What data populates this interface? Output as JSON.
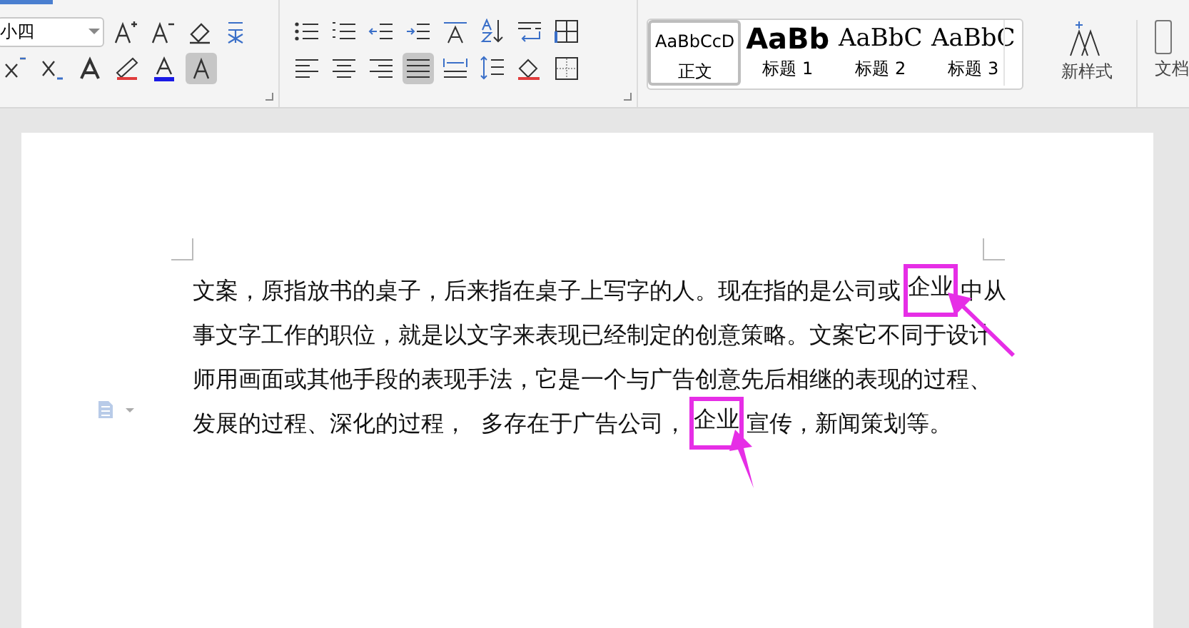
{
  "font_size": {
    "value": "小四"
  },
  "alignment": [
    {
      "kind": "left",
      "selected": false
    },
    {
      "kind": "center",
      "selected": false
    },
    {
      "kind": "right",
      "selected": false
    },
    {
      "kind": "justify",
      "selected": true
    },
    {
      "kind": "distribute",
      "selected": false
    }
  ],
  "styles": [
    {
      "kind": "normal",
      "preview": "AaBbCcD",
      "label": "正文",
      "selected": true
    },
    {
      "kind": "heading",
      "preview": "AaBb",
      "label": "标题 1",
      "selected": false
    },
    {
      "kind": "heading2",
      "preview": "AaBbC",
      "label": "标题 2",
      "selected": false
    },
    {
      "kind": "heading2",
      "preview": "AaBbC",
      "label": "标题 3",
      "selected": false
    }
  ],
  "new_style": {
    "label": "新样式"
  },
  "document_button": {
    "label": "文档"
  },
  "paragraph": [
    {
      "segments": [
        {
          "text": "文案，原指放书的桌子，后来指在桌子上写字的人。现在指的是公司或",
          "highlight": false
        },
        {
          "text": "企业",
          "highlight": true
        },
        {
          "text": "中从",
          "highlight": false
        }
      ]
    },
    {
      "segments": [
        {
          "text": "事文字工作的职位，就是以文字来表现已经制定的创意策略。文案它不同于设计",
          "highlight": false
        }
      ]
    },
    {
      "segments": [
        {
          "text": "师用画面或其他手段的表现手法，它是一个与广告创意先后相继的表现的过程、",
          "highlight": false
        }
      ]
    },
    {
      "segments": [
        {
          "text": "发展的过程、深化的过程，  多存在于广告公司，",
          "highlight": false
        },
        {
          "text": "企业",
          "highlight": true
        },
        {
          "text": "宣传，新闻策划等。",
          "highlight": false
        }
      ]
    }
  ]
}
